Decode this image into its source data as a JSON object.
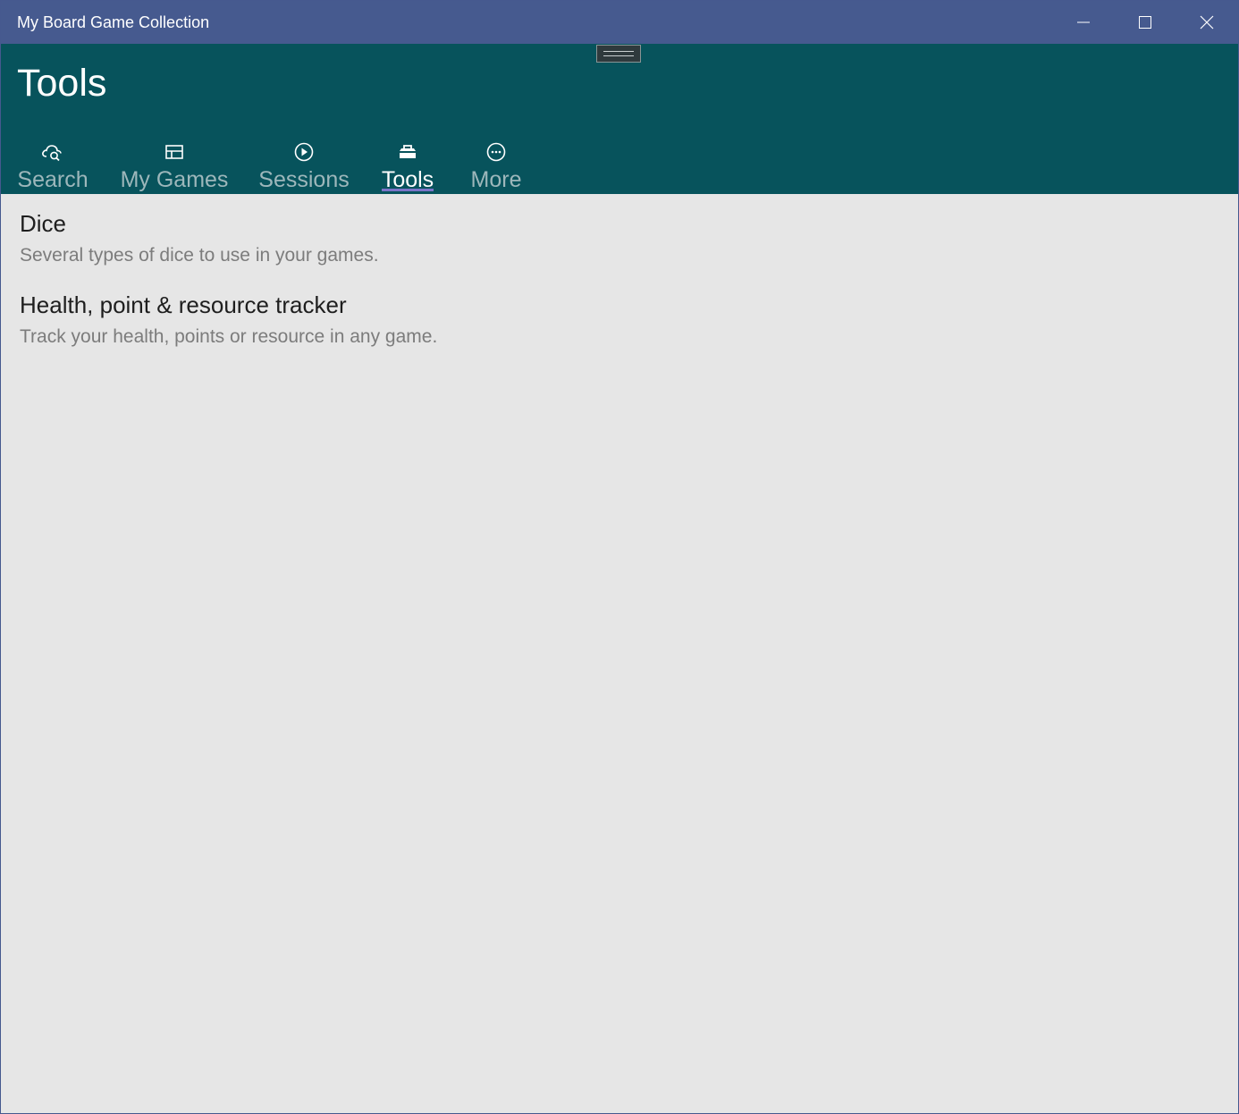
{
  "window": {
    "title": "My Board Game Collection",
    "controls": {
      "minimize_icon": "minimize-icon",
      "maximize_icon": "maximize-icon",
      "close_icon": "close-icon"
    }
  },
  "header": {
    "page_title": "Tools",
    "tabs": [
      {
        "label": "Search",
        "icon": "cloud-search-icon",
        "active": false
      },
      {
        "label": "My Games",
        "icon": "table-icon",
        "active": false
      },
      {
        "label": "Sessions",
        "icon": "play-circle-icon",
        "active": false
      },
      {
        "label": "Tools",
        "icon": "toolbox-icon",
        "active": true
      },
      {
        "label": "More",
        "icon": "more-circle-icon",
        "active": false
      }
    ]
  },
  "tools": [
    {
      "title": "Dice",
      "description": "Several types of dice to use in your games."
    },
    {
      "title": "Health, point & resource tracker",
      "description": "Track your health, points or resource in any game."
    }
  ],
  "colors": {
    "titlebar": "#465a8f",
    "header": "#07535c",
    "content_bg": "#e6e6e6",
    "active_tab_underline": "#7a74c8",
    "inactive_tab_text": "#9db7bb"
  }
}
